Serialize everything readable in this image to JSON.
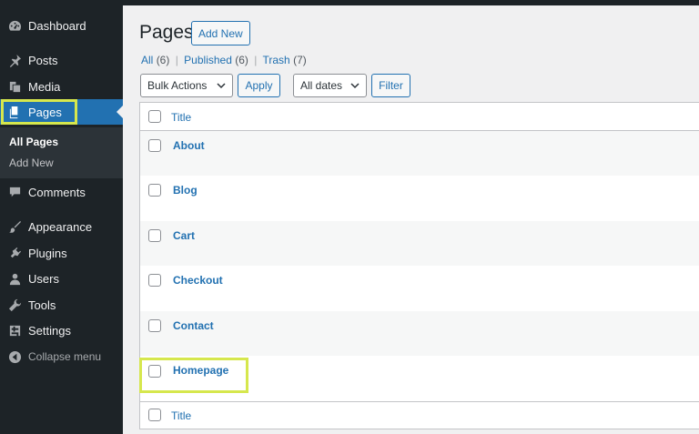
{
  "sidebar": {
    "items": [
      {
        "label": "Dashboard",
        "icon": "dashboard-icon"
      },
      {
        "label": "Posts",
        "icon": "pin-icon"
      },
      {
        "label": "Media",
        "icon": "media-icon"
      },
      {
        "label": "Pages",
        "icon": "pages-icon",
        "active": true
      },
      {
        "label": "Comments",
        "icon": "comment-icon"
      },
      {
        "label": "Appearance",
        "icon": "paintbrush-icon"
      },
      {
        "label": "Plugins",
        "icon": "plugin-icon"
      },
      {
        "label": "Users",
        "icon": "user-icon"
      },
      {
        "label": "Tools",
        "icon": "wrench-icon"
      },
      {
        "label": "Settings",
        "icon": "settings-icon"
      },
      {
        "label": "Collapse menu",
        "icon": "collapse-icon"
      }
    ],
    "submenu": [
      "All Pages",
      "Add New"
    ]
  },
  "header": {
    "title": "Pages",
    "add_new": "Add New"
  },
  "filters": {
    "all": "All",
    "all_count": "(6)",
    "published": "Published",
    "published_count": "(6)",
    "trash": "Trash",
    "trash_count": "(7)",
    "bulk_actions": "Bulk Actions",
    "apply": "Apply",
    "all_dates": "All dates",
    "filter": "Filter"
  },
  "table": {
    "column_title": "Title",
    "rows": [
      "About",
      "Blog",
      "Cart",
      "Checkout",
      "Contact",
      "Homepage"
    ]
  },
  "colors": {
    "sidebar_bg": "#1d2327",
    "accent": "#2271b1",
    "highlight": "#d6e74d"
  }
}
